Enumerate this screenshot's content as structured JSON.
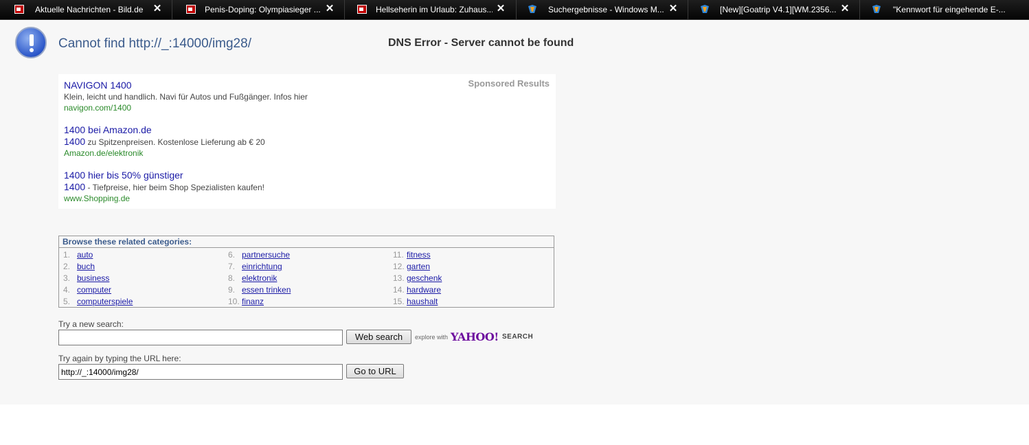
{
  "tabs": [
    {
      "title": "Aktuelle Nachrichten - Bild.de",
      "icon": "bild-favicon"
    },
    {
      "title": "Penis-Doping: Olympiasieger ...",
      "icon": "bild-favicon"
    },
    {
      "title": "Hellseherin im Urlaub: Zuhaus...",
      "icon": "bild-favicon"
    },
    {
      "title": "Suchergebnisse - Windows M...",
      "icon": "site-favicon"
    },
    {
      "title": "[New][Goatrip V4.1][WM.2356...",
      "icon": "site-favicon"
    },
    {
      "title": "\"Kennwort für eingehende E-...",
      "icon": "site-favicon"
    }
  ],
  "error": {
    "title": "Cannot find http://_:14000/img28/",
    "heading": "DNS Error - Server cannot be found"
  },
  "sponsored": {
    "label": "Sponsored Results",
    "ads": [
      {
        "title": "NAVIGON 1400",
        "desc_kw": "",
        "desc": "Klein, leicht und handlich. Navi für Autos und Fußgänger. Infos hier",
        "url": "navigon.com/1400"
      },
      {
        "title": "1400 bei Amazon.de",
        "desc_kw": "1400",
        "desc": " zu Spitzenpreisen. Kostenlose Lieferung ab € 20",
        "url": "Amazon.de/elektronik"
      },
      {
        "title": "1400 hier bis 50% günstiger",
        "desc_kw": "1400",
        "desc": " - Tiefpreise, hier beim Shop Spezialisten kaufen!",
        "url": "www.Shopping.de"
      }
    ]
  },
  "categories": {
    "heading": "Browse these related categories:",
    "items": [
      {
        "num": "1.",
        "label": "auto"
      },
      {
        "num": "2.",
        "label": "buch"
      },
      {
        "num": "3.",
        "label": "business"
      },
      {
        "num": "4.",
        "label": "computer"
      },
      {
        "num": "5.",
        "label": "computerspiele"
      },
      {
        "num": "6.",
        "label": "partnersuche"
      },
      {
        "num": "7.",
        "label": "einrichtung"
      },
      {
        "num": "8.",
        "label": "elektronik"
      },
      {
        "num": "9.",
        "label": "essen trinken"
      },
      {
        "num": "10.",
        "label": "finanz"
      },
      {
        "num": "11.",
        "label": "fitness"
      },
      {
        "num": "12.",
        "label": "garten"
      },
      {
        "num": "13.",
        "label": "geschenk"
      },
      {
        "num": "14.",
        "label": "hardware"
      },
      {
        "num": "15.",
        "label": "haushalt"
      }
    ]
  },
  "search": {
    "label": "Try a new search:",
    "value": "",
    "button": "Web search",
    "explore": "explore with",
    "brand": "YAHOO!",
    "brand_suffix": "SEARCH"
  },
  "url_form": {
    "label": "Try again by typing the URL here:",
    "value": "http://_:14000/img28/",
    "button": "Go to URL"
  }
}
